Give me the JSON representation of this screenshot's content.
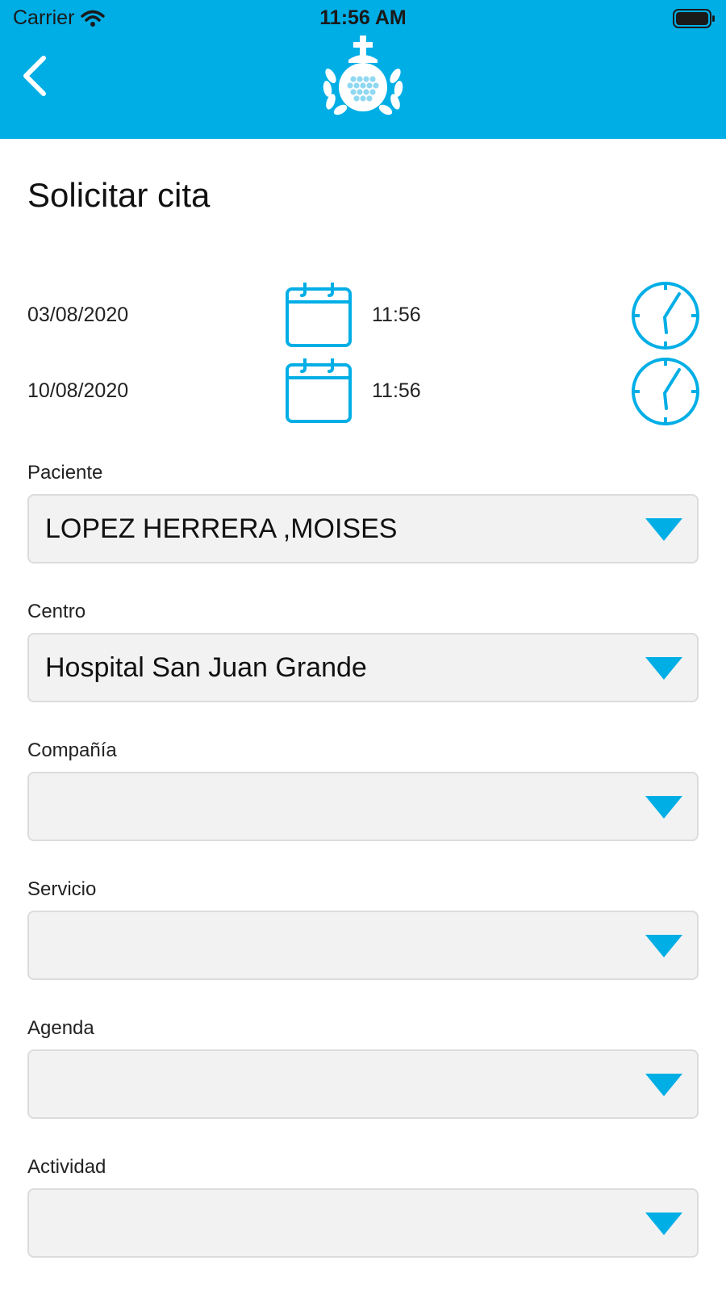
{
  "status_bar": {
    "carrier": "Carrier",
    "time": "11:56 AM"
  },
  "header": {
    "background_color": "#00aee6",
    "back_icon": "chevron-left-icon",
    "logo_icon": "hospital-order-logo"
  },
  "page": {
    "title": "Solicitar cita"
  },
  "date_ranges": [
    {
      "date": "03/08/2020",
      "time": "11:56",
      "date_icon": "calendar-icon",
      "time_icon": "clock-icon"
    },
    {
      "date": "10/08/2020",
      "time": "11:56",
      "date_icon": "calendar-icon",
      "time_icon": "clock-icon"
    }
  ],
  "fields": [
    {
      "label": "Paciente",
      "value": "LOPEZ HERRERA ,MOISES"
    },
    {
      "label": "Centro",
      "value": "Hospital San Juan Grande"
    },
    {
      "label": "Compañía",
      "value": ""
    },
    {
      "label": "Servicio",
      "value": ""
    },
    {
      "label": "Agenda",
      "value": ""
    },
    {
      "label": "Actividad",
      "value": ""
    }
  ],
  "colors": {
    "accent": "#00aee6",
    "select_background": "#f2f2f2",
    "select_border": "#dcdcdc"
  }
}
